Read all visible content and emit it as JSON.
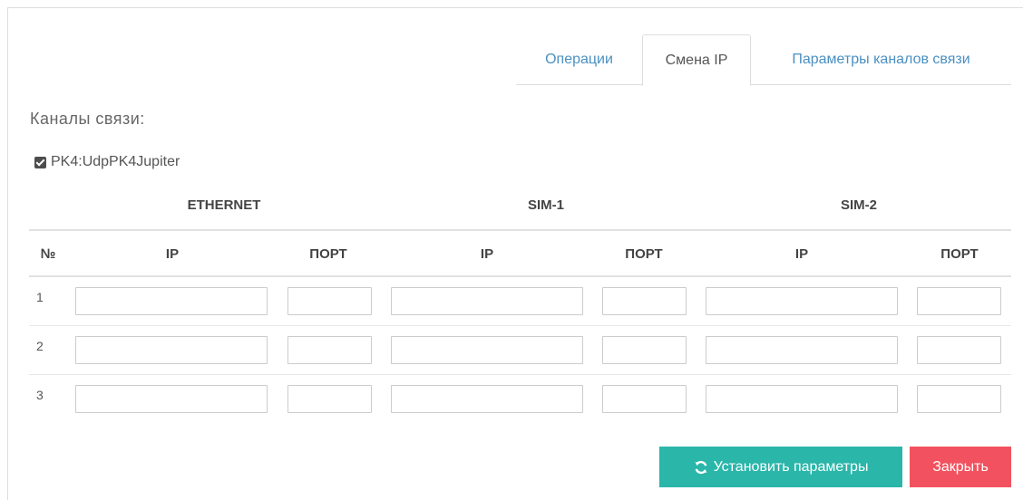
{
  "tabs": [
    {
      "label": "Операции",
      "active": false
    },
    {
      "label": "Смена IP",
      "active": true
    },
    {
      "label": "Параметры каналов связи",
      "active": false
    }
  ],
  "channels_label": "Каналы связи:",
  "channel": {
    "label": "PK4:UdpPK4Jupiter",
    "checked": true
  },
  "groups": [
    "ETHERNET",
    "SIM-1",
    "SIM-2"
  ],
  "columns": {
    "num": "№",
    "ip": "IP",
    "port": "ПОРТ"
  },
  "rows": [
    {
      "num": "1",
      "eth_ip": "",
      "eth_port": "",
      "sim1_ip": "",
      "sim1_port": "",
      "sim2_ip": "",
      "sim2_port": ""
    },
    {
      "num": "2",
      "eth_ip": "",
      "eth_port": "",
      "sim1_ip": "",
      "sim1_port": "",
      "sim2_ip": "",
      "sim2_port": ""
    },
    {
      "num": "3",
      "eth_ip": "",
      "eth_port": "",
      "sim1_ip": "",
      "sim1_port": "",
      "sim2_ip": "",
      "sim2_port": ""
    }
  ],
  "buttons": {
    "apply": {
      "label": "Установить параметры",
      "icon": "refresh-icon",
      "color": "#2bb6aa"
    },
    "close": {
      "label": "Закрыть",
      "color": "#f2525f"
    }
  },
  "colors": {
    "link": "#4a90c2",
    "border": "#dddddd"
  }
}
